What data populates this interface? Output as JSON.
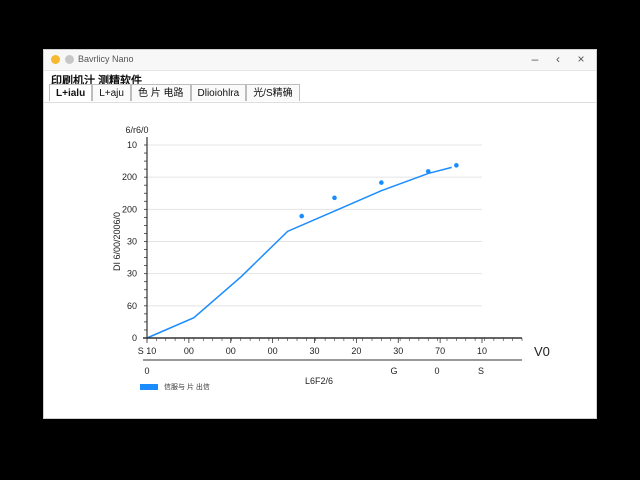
{
  "window": {
    "title": "Bavrlicy Nano",
    "min_icon": "minimize-icon",
    "back_icon": "chevron-left-icon",
    "close_icon": "close-icon"
  },
  "app": {
    "name": "印刷机汁 测精软件"
  },
  "tabs": [
    {
      "label": "L+ialu"
    },
    {
      "label": "L+aju"
    },
    {
      "label": "色 片 电路"
    },
    {
      "label": "Dlioiohlra"
    },
    {
      "label": "光/S精确"
    }
  ],
  "colors": {
    "accent": "#1a8cff",
    "fill": "#cfe6fb",
    "fill_top": "#f3f9ff",
    "grid": "#e4e4e4"
  },
  "chart_data": {
    "type": "area",
    "title": "",
    "ylabel_top": "6/r6/0",
    "ylabel_side": "DI 6/00/2006/0",
    "xlabel": "L6F2/6",
    "x_end_label": "V0",
    "yticks": [
      "0",
      "60",
      "30",
      "30",
      "200",
      "200",
      "10"
    ],
    "xticks": [
      "S 10",
      "00",
      "00",
      "00",
      "30",
      "20",
      "30",
      "70",
      "10"
    ],
    "x_sub_labels": [
      "0",
      "G",
      "0",
      "S"
    ],
    "x": [
      0,
      1,
      2,
      3,
      4,
      5,
      6,
      6.5
    ],
    "y": [
      0,
      20,
      60,
      105,
      125,
      145,
      162,
      168
    ],
    "markers": [
      {
        "x": 3.3,
        "y": 120
      },
      {
        "x": 4.0,
        "y": 138
      },
      {
        "x": 5.0,
        "y": 153
      },
      {
        "x": 6.0,
        "y": 164
      },
      {
        "x": 6.6,
        "y": 170
      }
    ],
    "ylim": [
      0,
      190
    ],
    "xlim": [
      0,
      8
    ],
    "legend": [
      {
        "name": "信服与 片 出信"
      }
    ],
    "legend_position": "bottom-left",
    "grid": true
  }
}
